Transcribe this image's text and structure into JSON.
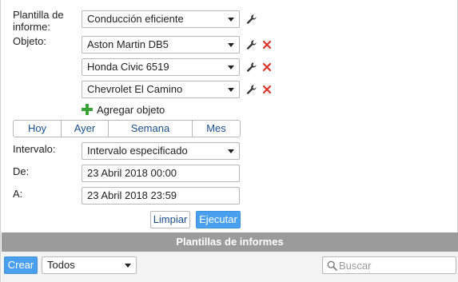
{
  "form": {
    "template_label": "Plantilla de informe:",
    "template_value": "Conducción eficiente",
    "object_label": "Objeto:",
    "objects": [
      "Aston Martin DB5",
      "Honda Civic 6519",
      "Chevrolet El Camino"
    ],
    "add_object_label": "Agregar objeto",
    "period_tabs": [
      "Hoy",
      "Ayer",
      "Semana",
      "Mes"
    ],
    "interval_label": "Intervalo:",
    "interval_value": "Intervalo especificado",
    "from_label": "De:",
    "from_value": "23 Abril 2018 00:00",
    "to_label": "A:",
    "to_value": "23 Abril 2018 23:59",
    "clear_label": "Limpiar",
    "execute_label": "Ejecutar"
  },
  "templates_section": {
    "title": "Plantillas de informes",
    "create_label": "Crear",
    "filter_value": "Todos",
    "search_placeholder": "Buscar"
  },
  "icons": {
    "settings": "wrench-icon",
    "remove": "delete-x-icon",
    "add": "plus-icon",
    "search": "search-icon",
    "dropdown": "caret-down-icon"
  },
  "colors": {
    "accent_blue": "#4aa0ef",
    "remove_red": "#d9372b",
    "add_green": "#3aa335",
    "section_gray": "#9b9b9b",
    "link_blue": "#1a4f8a"
  }
}
